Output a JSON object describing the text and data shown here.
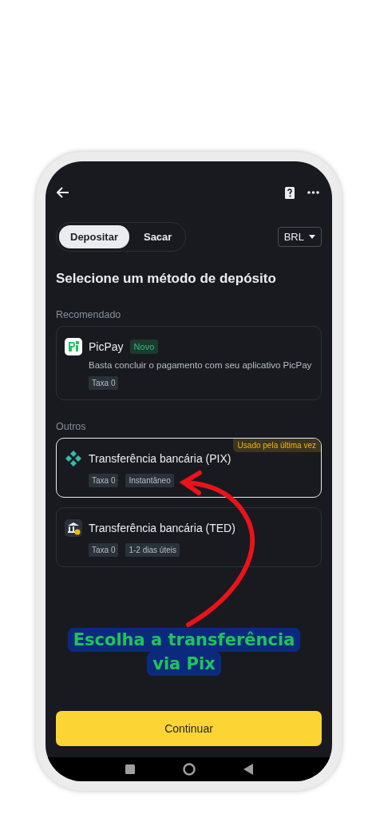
{
  "tabs": [
    {
      "label": "Depositar",
      "selected": true
    },
    {
      "label": "Sacar",
      "selected": false
    }
  ],
  "currency": "BRL",
  "heading": "Selecione um método de depósito",
  "sections": [
    {
      "title": "Recomendado",
      "methods": [
        {
          "kind": "app",
          "name": "PicPay",
          "badge": "Novo",
          "description": "Basta concluir o pagamento com seu aplicativo PicPay",
          "tags": [
            "Taxa 0"
          ],
          "selected": false
        }
      ]
    },
    {
      "title": "Outros",
      "methods": [
        {
          "kind": "pix",
          "name": "Transferência bancária (PIX)",
          "flag": "Usado pela última vez",
          "tags": [
            "Taxa 0",
            "Instantâneo"
          ],
          "selected": true
        },
        {
          "kind": "bank",
          "name": "Transferência bancária (TED)",
          "tags": [
            "Taxa 0",
            "1-2 dias úteis"
          ],
          "selected": false
        }
      ]
    }
  ],
  "annotation": {
    "lines": [
      "Escolha a transferência",
      "via Pix"
    ]
  },
  "continue_button": "Continuar"
}
